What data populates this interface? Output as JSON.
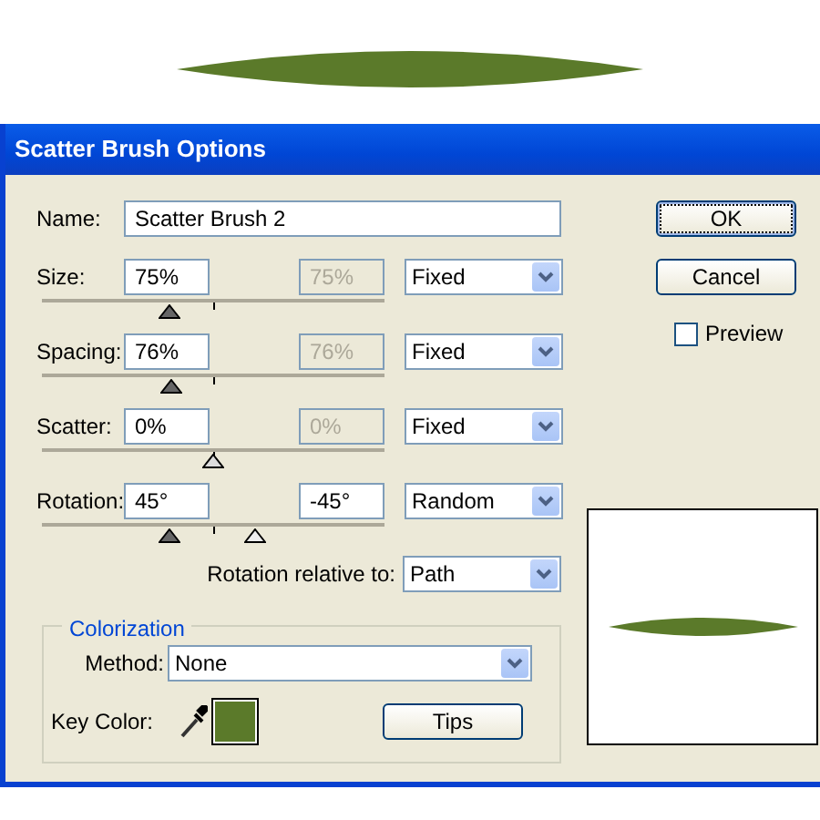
{
  "window": {
    "title": "Scatter Brush Options"
  },
  "name": {
    "label": "Name:",
    "value": "Scatter Brush 2"
  },
  "parameters": [
    {
      "label": "Size:",
      "value": "75%",
      "value2": "75%",
      "value2_disabled": true,
      "variation": "Fixed",
      "thumbs": [
        {
          "level": 0.37
        }
      ]
    },
    {
      "label": "Spacing:",
      "value": "76%",
      "value2": "76%",
      "value2_disabled": true,
      "variation": "Fixed",
      "thumbs": [
        {
          "level": 0.38
        }
      ]
    },
    {
      "label": "Scatter:",
      "value": "0%",
      "value2": "0%",
      "value2_disabled": true,
      "variation": "Fixed",
      "thumbs": [
        {
          "level": 0.5
        }
      ]
    },
    {
      "label": "Rotation:",
      "value": "45°",
      "value2": "-45°",
      "value2_disabled": false,
      "variation": "Random",
      "thumbs": [
        {
          "level": 0.37
        },
        {
          "level": 0.62
        }
      ]
    }
  ],
  "rotation_relative": {
    "label": "Rotation relative to:",
    "value": "Path"
  },
  "colorization": {
    "legend": "Colorization",
    "method_label": "Method:",
    "method": "None",
    "key_color_label": "Key Color:",
    "tips_button": "Tips"
  },
  "buttons": [
    {
      "label": "OK",
      "default": true
    },
    {
      "label": "Cancel",
      "default": false
    }
  ],
  "preview": {
    "label": "Preview",
    "checked": false
  }
}
